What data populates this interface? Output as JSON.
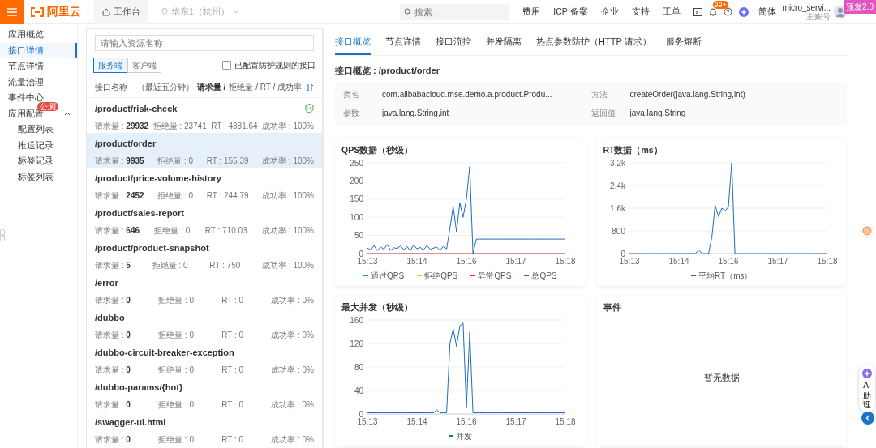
{
  "header": {
    "logo": "阿里云",
    "workspace": "工作台",
    "region": "华东1（杭州）",
    "search": {
      "placeholder": "搜索..."
    },
    "links": [
      "费用",
      "ICP 备案",
      "企业",
      "支持",
      "工单"
    ],
    "notification_badge": "99+",
    "language": "简体",
    "account": {
      "name": "micro_servi...",
      "role": "主账号"
    },
    "env_badge": "预发2.0"
  },
  "sidebar": {
    "items": [
      {
        "label": "应用概览",
        "selected": false
      },
      {
        "label": "接口详情",
        "selected": true
      },
      {
        "label": "节点详情",
        "selected": false
      },
      {
        "label": "流量治理",
        "selected": false
      },
      {
        "label": "事件中心",
        "selected": false
      },
      {
        "label": "应用配置",
        "selected": false,
        "badge": "公测",
        "expanded": true,
        "children": [
          {
            "label": "配置列表",
            "selected": false
          },
          {
            "label": "推送记录",
            "selected": false
          },
          {
            "label": "标签记录",
            "selected": false
          },
          {
            "label": "标签列表",
            "selected": false
          }
        ]
      }
    ]
  },
  "resource_list": {
    "search": {
      "placeholder": "请输入资源名称"
    },
    "segments": [
      {
        "label": "服务端",
        "selected": true
      },
      {
        "label": "客户端",
        "selected": false
      }
    ],
    "filter": {
      "label": "已配置防护规则的接口",
      "checked": false
    },
    "header": {
      "name": "接口名称",
      "period": "（最近五分钟）",
      "sort_key": "请求量 /",
      "other_keys": "拒绝量 / RT / 成功率"
    },
    "items": [
      {
        "name": "/product/risk-check",
        "protected": true,
        "selected": false,
        "requests": "请求量 : **29932**",
        "rejected": "拒绝量 : 23741",
        "rt": "RT : 4381.64",
        "success": "成功率 : 100%"
      },
      {
        "name": "/product/order",
        "protected": false,
        "selected": true,
        "requests": "请求量 : **9935**",
        "rejected": "拒绝量 : 0",
        "rt": "RT : 155.39",
        "success": "成功率 : 100%"
      },
      {
        "name": "/product/price-volume-history",
        "protected": false,
        "selected": false,
        "requests": "请求量 : **2452**",
        "rejected": "拒绝量 : 0",
        "rt": "RT : 244.79",
        "success": "成功率 : 100%"
      },
      {
        "name": "/product/sales-report",
        "protected": false,
        "selected": false,
        "requests": "请求量 : **646**",
        "rejected": "拒绝量 : 0",
        "rt": "RT : 710.03",
        "success": "成功率 : 100%"
      },
      {
        "name": "/product/product-snapshot",
        "protected": false,
        "selected": false,
        "requests": "请求量 : **5**",
        "rejected": "拒绝量 : 0",
        "rt": "RT : 750",
        "success": "成功率 : 100%"
      },
      {
        "name": "/error",
        "protected": false,
        "selected": false,
        "requests": "请求量 : **0**",
        "rejected": "拒绝量 : 0",
        "rt": "RT : 0",
        "success": "成功率 : 0%"
      },
      {
        "name": "/dubbo",
        "protected": false,
        "selected": false,
        "requests": "请求量 : **0**",
        "rejected": "拒绝量 : 0",
        "rt": "RT : 0",
        "success": "成功率 : 0%"
      },
      {
        "name": "/dubbo-circuit-breaker-exception",
        "protected": false,
        "selected": false,
        "requests": "请求量 : **0**",
        "rejected": "拒绝量 : 0",
        "rt": "RT : 0",
        "success": "成功率 : 0%"
      },
      {
        "name": "/dubbo-params/{hot}",
        "protected": false,
        "selected": false,
        "requests": "请求量 : **0**",
        "rejected": "拒绝量 : 0",
        "rt": "RT : 0",
        "success": "成功率 : 0%"
      },
      {
        "name": "/swagger-ui.html",
        "protected": false,
        "selected": false,
        "requests": "请求量 : **0**",
        "rejected": "拒绝量 : 0",
        "rt": "RT : 0",
        "success": "成功率 : 0%"
      }
    ]
  },
  "detail": {
    "tabs": [
      {
        "label": "接口概览",
        "selected": true
      },
      {
        "label": "节点详情",
        "selected": false
      },
      {
        "label": "接口流控",
        "selected": false
      },
      {
        "label": "并发隔离",
        "selected": false
      },
      {
        "label": "热点参数防护（HTTP 请求）",
        "selected": false
      },
      {
        "label": "服务熔断",
        "selected": false
      }
    ],
    "title": "接口概览 : /product/order",
    "info": [
      {
        "label": "类名",
        "value": "com.alibabacloud.mse.demo.a.product.Produ..."
      },
      {
        "label": "方法",
        "value": "createOrder(java.lang.String,int)"
      },
      {
        "label": "参数",
        "value": "java.lang.String,int"
      },
      {
        "label": "返回值",
        "value": "java.lang.String"
      }
    ],
    "charts": [
      {
        "title": "QPS数据（秒级）",
        "chart_data": {
          "type": "line",
          "grid": true,
          "legend": "bottom",
          "ylim": [
            0,
            250
          ],
          "yticks": [
            0,
            50,
            100,
            150,
            200,
            250
          ],
          "categories": [
            "15:13",
            null,
            null,
            null,
            null,
            null,
            null,
            null,
            null,
            null,
            null,
            null,
            null,
            null,
            null,
            "15:14",
            null,
            null,
            null,
            null,
            null,
            null,
            null,
            null,
            null,
            null,
            null,
            null,
            null,
            null,
            "15:16",
            null,
            null,
            null,
            null,
            null,
            null,
            null,
            null,
            null,
            null,
            null,
            null,
            null,
            null,
            "15:17",
            null,
            null,
            null,
            null,
            null,
            null,
            null,
            null,
            null,
            null,
            null,
            null,
            null,
            null,
            "15:18"
          ],
          "series": [
            {
              "name": "通过QPS",
              "color": "#2fa84f",
              "values": [
                null,
                null,
                null,
                null,
                null,
                null,
                null,
                null,
                null,
                null,
                null,
                null,
                null,
                null,
                null,
                null,
                null,
                null,
                null,
                null,
                null,
                null,
                null,
                null,
                null,
                null,
                null,
                null,
                null,
                null,
                null,
                null,
                null,
                null,
                null,
                null,
                null,
                null,
                null,
                null,
                null,
                null,
                null,
                null,
                null,
                null,
                null,
                null,
                null,
                null,
                null,
                null,
                null,
                null,
                null,
                null,
                null,
                null,
                null,
                null,
                null
              ]
            },
            {
              "name": "拒绝QPS",
              "color": "#f2c11d",
              "values": [
                null,
                null,
                null,
                null,
                null,
                null,
                null,
                null,
                null,
                null,
                null,
                null,
                null,
                null,
                null,
                null,
                null,
                null,
                null,
                null,
                null,
                null,
                null,
                null,
                null,
                null,
                null,
                null,
                null,
                null,
                null,
                null,
                null,
                null,
                null,
                null,
                null,
                null,
                null,
                null,
                null,
                null,
                null,
                null,
                null,
                null,
                null,
                null,
                null,
                null,
                null,
                null,
                null,
                null,
                null,
                null,
                null,
                null,
                null,
                null,
                null
              ]
            },
            {
              "name": "异常QPS",
              "color": "#d9363e",
              "values": [
                0,
                0,
                0,
                0,
                0,
                0,
                0,
                0,
                0,
                0,
                0,
                0,
                0,
                0,
                0,
                0,
                0,
                0,
                0,
                0,
                0,
                0,
                0,
                0,
                0,
                0,
                0,
                0,
                0,
                0,
                0,
                0,
                0,
                0,
                0,
                0,
                0,
                0,
                0,
                0,
                0,
                0,
                0,
                0,
                0,
                0,
                0,
                0,
                0,
                0,
                0,
                0,
                0,
                0,
                0,
                0,
                0,
                0,
                0,
                0,
                0
              ]
            },
            {
              "name": "总QPS",
              "color": "#1f6cc0",
              "values": [
                15,
                10,
                22,
                8,
                18,
                12,
                25,
                9,
                16,
                14,
                21,
                11,
                19,
                8,
                24,
                13,
                17,
                10,
                22,
                12,
                15,
                18,
                9,
                20,
                13,
                70,
                130,
                60,
                140,
                100,
                150,
                240,
                0,
                40,
                40,
                40,
                40,
                40,
                40,
                40,
                40,
                40,
                40,
                40,
                40,
                40,
                40,
                40,
                40,
                40,
                40,
                40,
                40,
                40,
                40,
                40,
                40,
                40,
                40,
                40,
                40
              ]
            }
          ]
        }
      },
      {
        "title": "RT数据（ms）",
        "chart_data": {
          "type": "line",
          "grid": true,
          "legend": "bottom",
          "ylim": [
            0,
            3200
          ],
          "yticks": [
            {
              "value": 0,
              "label": "0"
            },
            {
              "value": 800,
              "label": "800"
            },
            {
              "value": 1600,
              "label": "1.6k"
            },
            {
              "value": 2400,
              "label": "2.4k"
            },
            {
              "value": 3200,
              "label": "3.2k"
            }
          ],
          "categories": [
            "15:13",
            null,
            null,
            null,
            null,
            null,
            null,
            null,
            null,
            null,
            null,
            null,
            null,
            null,
            null,
            "15:14",
            null,
            null,
            null,
            null,
            null,
            null,
            null,
            null,
            null,
            null,
            null,
            null,
            null,
            null,
            "15:16",
            null,
            null,
            null,
            null,
            null,
            null,
            null,
            null,
            null,
            null,
            null,
            null,
            null,
            null,
            "15:17",
            null,
            null,
            null,
            null,
            null,
            null,
            null,
            null,
            null,
            null,
            null,
            null,
            null,
            null,
            "15:18"
          ],
          "series": [
            {
              "name": "平均RT（ms）",
              "color": "#1f6cc0",
              "values": [
                0,
                0,
                0,
                0,
                0,
                0,
                0,
                0,
                0,
                0,
                0,
                0,
                0,
                0,
                0,
                0,
                0,
                0,
                0,
                0,
                0,
                130,
                0,
                0,
                0,
                600,
                1700,
                1300,
                1600,
                1500,
                1650,
                3200,
                0,
                0,
                0,
                0,
                0,
                0,
                0,
                0,
                0,
                0,
                0,
                0,
                0,
                0,
                0,
                0,
                0,
                0,
                0,
                0,
                0,
                0,
                0,
                0,
                0,
                0,
                0,
                0,
                0
              ]
            }
          ]
        }
      },
      {
        "title": "最大并发（秒级）",
        "chart_data": {
          "type": "line",
          "grid": true,
          "legend": "bottom",
          "ylim": [
            0,
            160
          ],
          "yticks": [
            0,
            40,
            80,
            120,
            160
          ],
          "categories": [
            "15:13",
            null,
            null,
            null,
            null,
            null,
            null,
            null,
            null,
            null,
            null,
            null,
            null,
            null,
            null,
            "15:14",
            null,
            null,
            null,
            null,
            null,
            null,
            null,
            null,
            null,
            null,
            null,
            null,
            null,
            null,
            "15:16",
            null,
            null,
            null,
            null,
            null,
            null,
            null,
            null,
            null,
            null,
            null,
            null,
            null,
            null,
            "15:17",
            null,
            null,
            null,
            null,
            null,
            null,
            null,
            null,
            null,
            null,
            null,
            null,
            null,
            null,
            "15:18"
          ],
          "series": [
            {
              "name": "并发",
              "color": "#1f6cc0",
              "values": [
                2,
                2,
                2,
                2,
                2,
                2,
                2,
                2,
                2,
                2,
                2,
                2,
                2,
                2,
                2,
                2,
                2,
                2,
                2,
                2,
                2,
                7,
                2,
                2,
                2,
                120,
                145,
                115,
                150,
                155,
                10,
                140,
                2,
                2,
                2,
                2,
                2,
                2,
                2,
                2,
                2,
                2,
                2,
                2,
                2,
                2,
                2,
                2,
                2,
                2,
                2,
                2,
                2,
                2,
                2,
                2,
                2,
                2,
                2,
                2,
                2
              ]
            }
          ]
        }
      }
    ],
    "events": {
      "title": "事件",
      "empty": "暂无数据"
    }
  },
  "assistant": {
    "label": "AI",
    "sublabel": "助理"
  }
}
